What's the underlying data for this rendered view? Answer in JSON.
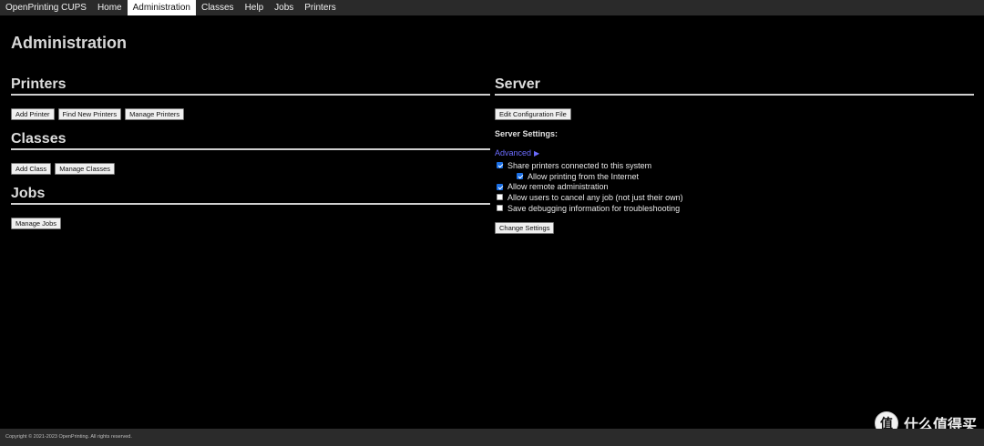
{
  "nav": {
    "brand": "OpenPrinting CUPS",
    "items": [
      "Home",
      "Administration",
      "Classes",
      "Help",
      "Jobs",
      "Printers"
    ],
    "active": "Administration"
  },
  "page": {
    "title": "Administration"
  },
  "printers": {
    "title": "Printers",
    "buttons": [
      "Add Printer",
      "Find New Printers",
      "Manage Printers"
    ]
  },
  "classes": {
    "title": "Classes",
    "buttons": [
      "Add Class",
      "Manage Classes"
    ]
  },
  "jobs": {
    "title": "Jobs",
    "buttons": [
      "Manage Jobs"
    ]
  },
  "server": {
    "title": "Server",
    "edit_config_button": "Edit Configuration File",
    "settings_label": "Server Settings:",
    "advanced_link": "Advanced",
    "advanced_glyph": "▶",
    "options": [
      {
        "label": "Share printers connected to this system",
        "checked": true,
        "indent": false
      },
      {
        "label": "Allow printing from the Internet",
        "checked": true,
        "indent": true
      },
      {
        "label": "Allow remote administration",
        "checked": true,
        "indent": false
      },
      {
        "label": "Allow users to cancel any job (not just their own)",
        "checked": false,
        "indent": false
      },
      {
        "label": "Save debugging information for troubleshooting",
        "checked": false,
        "indent": false
      }
    ],
    "change_button": "Change Settings"
  },
  "footer": {
    "copyright": "Copyright © 2021-2023 OpenPrinting. All rights reserved."
  },
  "watermark": {
    "glyph": "值",
    "text": "什么值得买"
  },
  "colors": {
    "background": "#000000",
    "nav_bg": "#2a2a2a",
    "link": "#6c6cff",
    "checkbox_checked": "#1a6fe6"
  }
}
